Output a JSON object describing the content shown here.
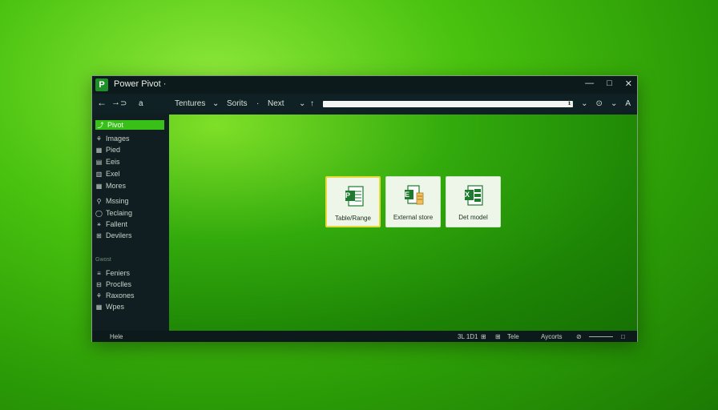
{
  "window": {
    "title": "Power Pivot ·",
    "logo": "P"
  },
  "controls": {
    "minimize": "—",
    "maximize": "□",
    "close": "✕"
  },
  "toolbar": {
    "back": "←",
    "forward": "→",
    "forward_extra": "⊃",
    "a_icon": "a",
    "tables": "Tentures",
    "tables_arrow": "⌄",
    "sorts": "Sorits",
    "sorts_arrow": "·",
    "next": "Next",
    "next_arrow": "⌄",
    "next_up": "↑",
    "search_glyph": "ℹ",
    "right1": "ⅎ",
    "right2": "⌄",
    "right3": "⊙",
    "right4": "⌄",
    "right5": "A"
  },
  "sidebar": {
    "items": [
      {
        "icon": "⤴",
        "label": "Pivot",
        "active": true
      },
      {
        "icon": "⚘",
        "label": "Images"
      },
      {
        "icon": "▦",
        "label": "Pied"
      },
      {
        "icon": "▤",
        "label": "Eeis"
      },
      {
        "icon": "▥",
        "label": "Exel"
      },
      {
        "icon": "▦",
        "label": "Mores"
      },
      {
        "icon": "⚲",
        "label": "Mssing"
      },
      {
        "icon": "◯",
        "label": "Teclaing"
      },
      {
        "icon": "⚹",
        "label": "Fallent"
      },
      {
        "icon": "⊞",
        "label": "Devilers"
      }
    ],
    "section_label": "Gwost",
    "items2": [
      {
        "icon": "≡",
        "label": "Feniers"
      },
      {
        "icon": "⊟",
        "label": "Proclles"
      },
      {
        "icon": "⚘",
        "label": "Raxones"
      },
      {
        "icon": "▦",
        "label": "Wpes"
      }
    ]
  },
  "cards": [
    {
      "label": "Table/Range",
      "glyph_letter": "P",
      "selected": true
    },
    {
      "label": "External store",
      "glyph_letter": "E",
      "selected": false
    },
    {
      "label": "Det model",
      "glyph_letter": "X",
      "selected": false
    }
  ],
  "statusbar": {
    "left": "Hele",
    "readout": "3L 1D1",
    "tab_icon": "⊞",
    "tab_label": "Tele",
    "mode": "Aycorts",
    "zoom_icon": "⊘",
    "expand": "□"
  },
  "colors": {
    "accent": "#38c018",
    "card_selected_border": "#e6d93a",
    "excel_green": "#1e7a2e"
  }
}
